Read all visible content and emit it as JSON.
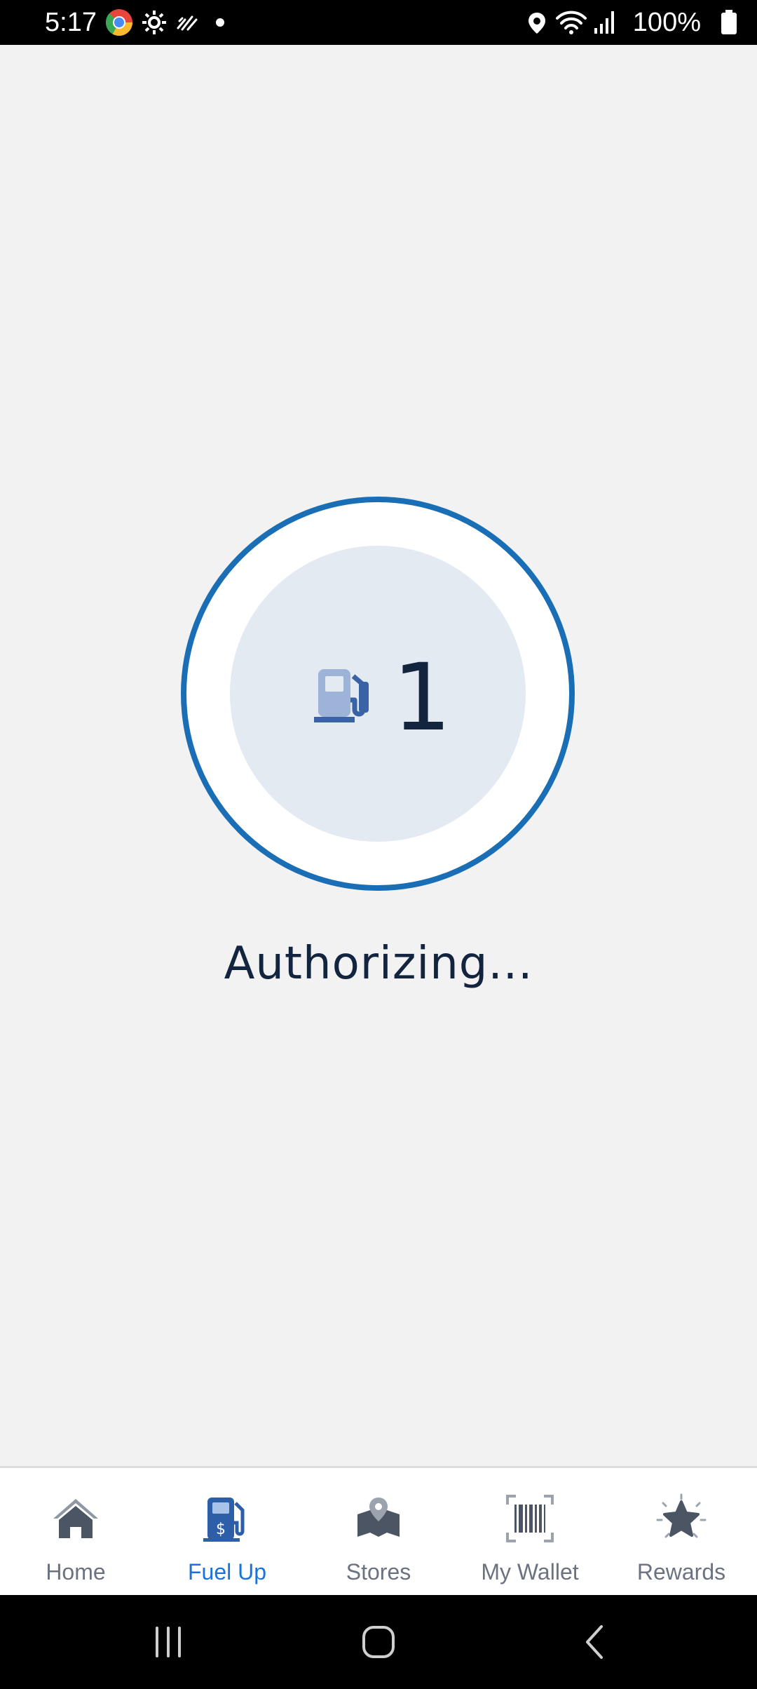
{
  "status_bar": {
    "time": "5:17",
    "battery_percent": "100%",
    "icons": [
      "chrome-icon",
      "settings-icon",
      "signal-mute-icon",
      "dot-icon",
      "location-icon",
      "wifi-icon",
      "cell-signal-icon",
      "battery-icon"
    ]
  },
  "pump": {
    "number": "1",
    "status_message": "Authorizing..."
  },
  "colors": {
    "accent": "#1a6eb5",
    "active_tab": "#1a73d9",
    "inactive_tab": "#6b7280",
    "text_dark": "#13243f"
  },
  "tabs": [
    {
      "label": "Home",
      "icon": "home-icon",
      "active": false
    },
    {
      "label": "Fuel Up",
      "icon": "fuel-pump-dollar-icon",
      "active": true
    },
    {
      "label": "Stores",
      "icon": "map-pin-icon",
      "active": false
    },
    {
      "label": "My Wallet",
      "icon": "barcode-icon",
      "active": false
    },
    {
      "label": "Rewards",
      "icon": "star-burst-icon",
      "active": false
    }
  ],
  "nav_bar": {
    "buttons": [
      "recents-icon",
      "home-circle-icon",
      "back-icon"
    ]
  }
}
